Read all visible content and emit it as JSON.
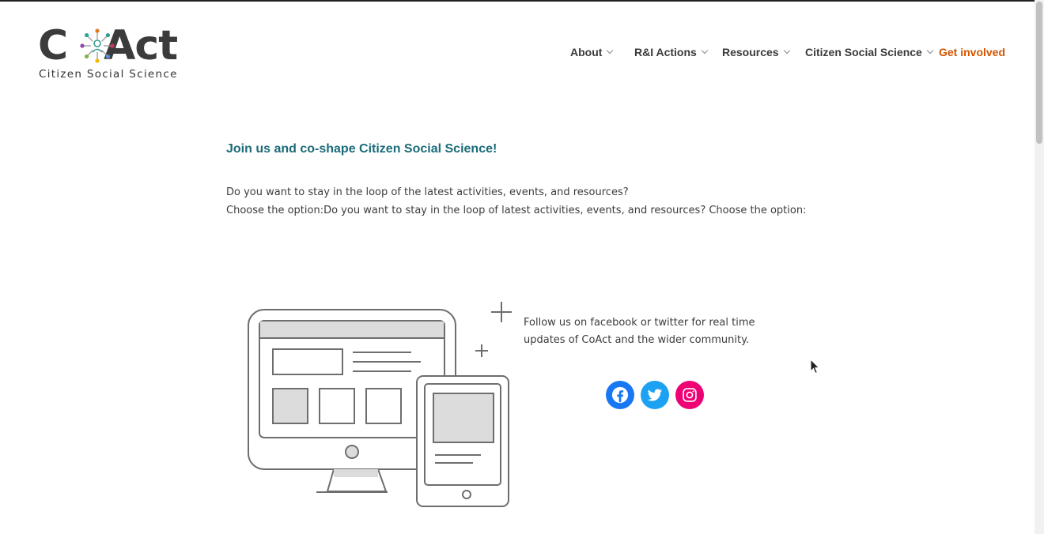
{
  "logo": {
    "letter_c": "C",
    "letters_act": "Act",
    "subtitle": "Citizen Social Science",
    "hub_colors": [
      "#e07b24",
      "#2e9c8f",
      "#c43b5a",
      "#5a8fd6",
      "#f2b705",
      "#7cb342",
      "#8e44ad",
      "#26a69a"
    ]
  },
  "nav": {
    "items": [
      {
        "label": "About",
        "has_dropdown": true
      },
      {
        "label": "R&I Actions",
        "has_dropdown": true
      },
      {
        "label": "Resources",
        "has_dropdown": true
      },
      {
        "label": "Citizen Social Science",
        "has_dropdown": true
      },
      {
        "label": "Get involved",
        "has_dropdown": false
      }
    ],
    "highlight_color": "#d35400"
  },
  "content": {
    "heading": "Join us and co-shape Citizen Social Science!",
    "heading_color": "#1a6b78",
    "paragraph_line1": "Do you want to stay in the loop of the latest activities, events, and resources?",
    "paragraph_line2": "Choose the option:Do you want to stay in the loop of latest activities, events, and resources? Choose the option:",
    "follow_text": "Follow us on facebook or twitter for real time updates of CoAct and the wider community."
  },
  "social": [
    {
      "name": "facebook-icon",
      "color": "#1877f2"
    },
    {
      "name": "twitter-icon",
      "color": "#1da1f2"
    },
    {
      "name": "instagram-icon",
      "color": "#f00075"
    }
  ]
}
